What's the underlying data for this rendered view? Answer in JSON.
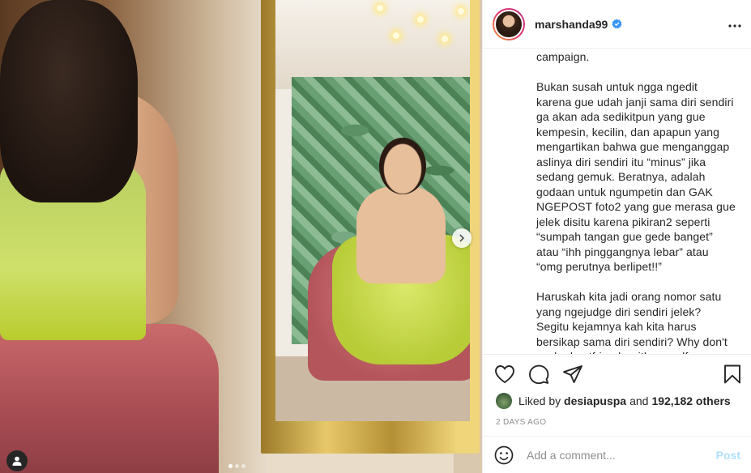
{
  "post": {
    "username": "marshanda99",
    "verified": true,
    "more_icon": "more-icon",
    "caption_paragraphs": [
      "campaign.",
      "Bukan susah untuk ngga ngedit karena gue udah janji sama diri sendiri ga akan ada sedikitpun yang gue kempesin, kecilin, dan apapun yang mengartikan bahwa gue menganggap aslinya diri sendiri itu “minus” jika sedang gemuk. Beratnya, adalah godaan untuk ngumpetin dan GAK NGEPOST foto2 yang gue merasa gue jelek disitu karena pikiran2 seperti “sumpah tangan gue gede banget” atau “ihh pinggangnya lebar” atau “omg perutnya berlipet!!”",
      "Haruskah kita jadi orang nomor satu yang ngejudge diri sendiri jelek? Segitu kejamnya kah kita harus bersikap sama diri sendiri? Why don't we be bestfriends with ourself"
    ],
    "likes": {
      "prefix": "Liked by",
      "first_user": "desiapuspa",
      "conjunction": "and",
      "others": "192,182 others"
    },
    "timestamp": "2 DAYS AGO",
    "comment": {
      "placeholder": "Add a comment...",
      "post_label": "Post",
      "emoji_icon": "emoji-icon"
    },
    "actions": {
      "like_icon": "heart-icon",
      "comment_icon": "comment-icon",
      "share_icon": "share-icon",
      "save_icon": "bookmark-icon"
    },
    "carousel": {
      "current": 1,
      "total": 3
    },
    "colors": {
      "verified_blue": "#3897f0",
      "post_button_disabled": "#b2dffc",
      "muted_text": "#8e8e8e"
    }
  }
}
